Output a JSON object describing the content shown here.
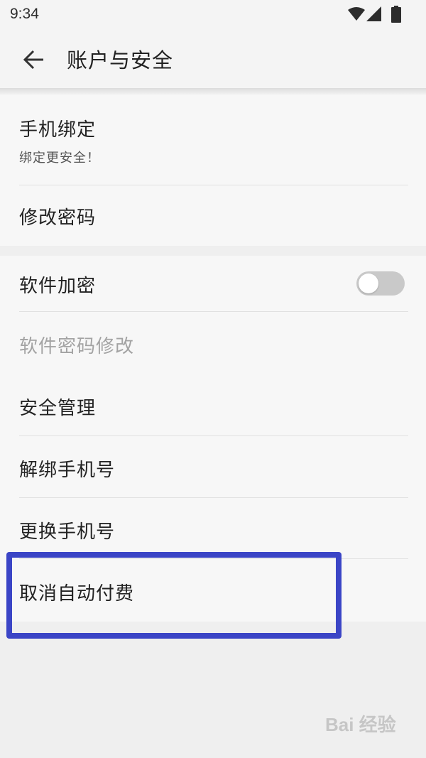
{
  "status_bar": {
    "time": "9:34"
  },
  "app_bar": {
    "title": "账户与安全"
  },
  "group_1": {
    "items": [
      {
        "label": "手机绑定",
        "subtitle": "绑定更安全！"
      },
      {
        "label": "修改密码"
      }
    ]
  },
  "group_2": {
    "items": [
      {
        "label": "软件加密",
        "toggle_on": false
      },
      {
        "label": "软件密码修改",
        "disabled": true
      },
      {
        "label": "安全管理"
      },
      {
        "label": "解绑手机号"
      },
      {
        "label": "更换手机号"
      },
      {
        "label": "取消自动付费",
        "highlighted": true
      }
    ]
  },
  "watermark": {
    "text": "Bai 经验"
  },
  "colors": {
    "highlight": "#3b45c6",
    "toggle_off": "#c9c9c9",
    "disabled_text": "#a3a3a3"
  }
}
